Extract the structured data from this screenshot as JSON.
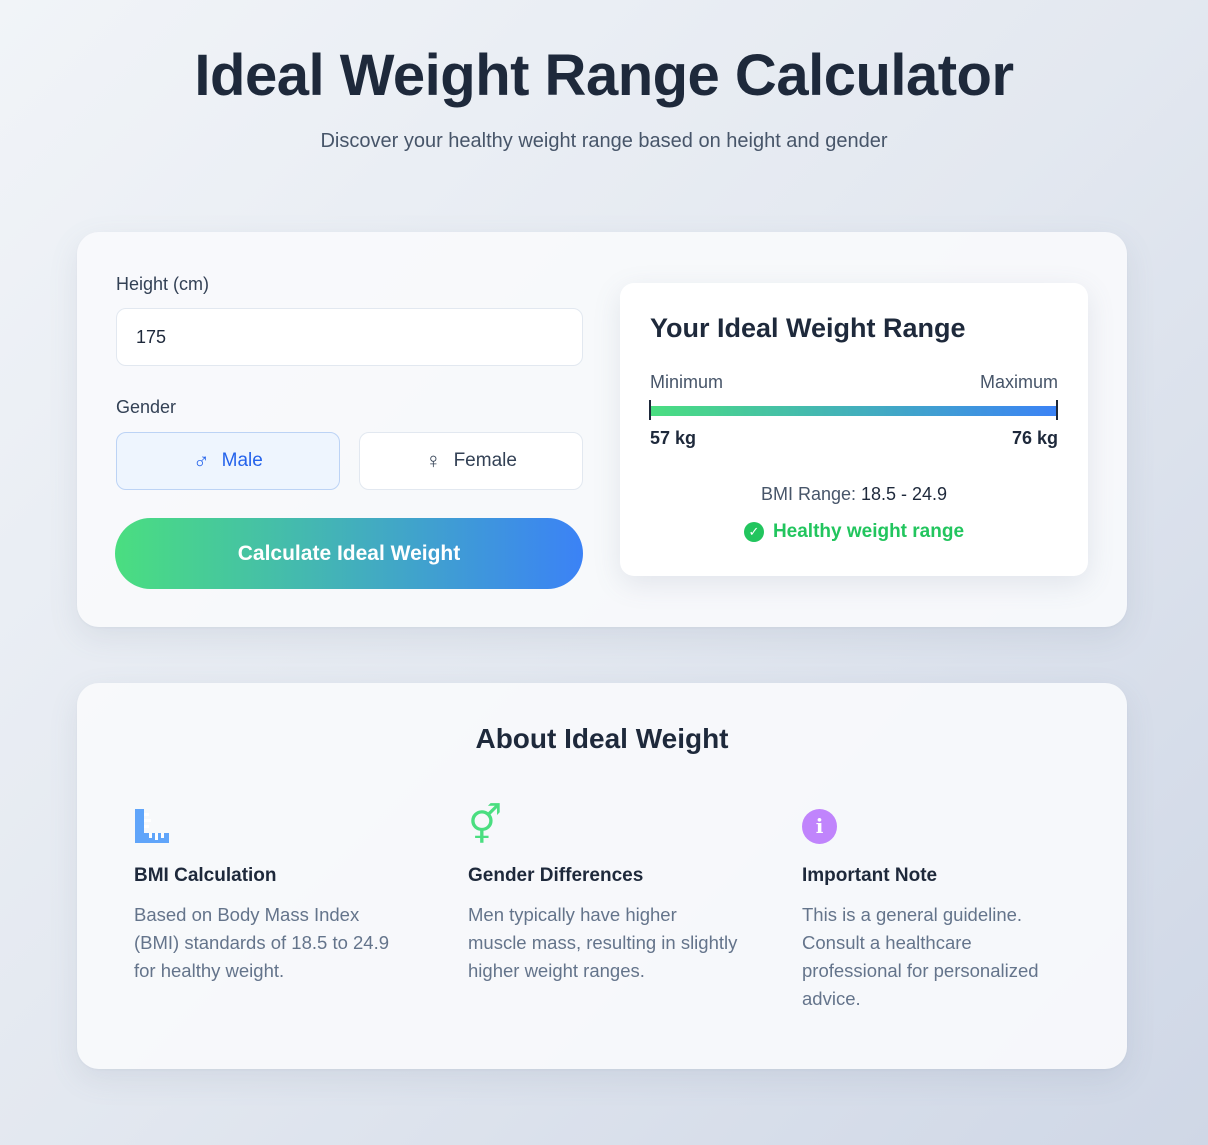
{
  "header": {
    "title": "Ideal Weight Range Calculator",
    "subtitle": "Discover your healthy weight range based on height and gender"
  },
  "form": {
    "height_label": "Height (cm)",
    "height_value": "175",
    "gender_label": "Gender",
    "male_label": "Male",
    "female_label": "Female",
    "selected_gender": "Male",
    "calculate_label": "Calculate Ideal Weight"
  },
  "result": {
    "title": "Your Ideal Weight Range",
    "min_label": "Minimum",
    "max_label": "Maximum",
    "min_value": "57 kg",
    "max_value": "76 kg",
    "bmi_label": "BMI Range:",
    "bmi_value": "18.5 - 24.9",
    "status": "Healthy weight range"
  },
  "about": {
    "title": "About Ideal Weight",
    "items": [
      {
        "icon": "ruler-icon",
        "title": "BMI Calculation",
        "text": "Based on Body Mass Index (BMI) standards of 18.5 to 24.9 for healthy weight."
      },
      {
        "icon": "gender-symbols-icon",
        "title": "Gender Differences",
        "text": "Men typically have higher muscle mass, resulting in slightly higher weight ranges."
      },
      {
        "icon": "info-icon",
        "title": "Important Note",
        "text": "This is a general guideline. Consult a healthcare professional for personalized advice."
      }
    ]
  },
  "colors": {
    "accent_green": "#4ade80",
    "accent_blue": "#3b82f6",
    "status_green": "#22c55e",
    "info_purple": "#c084fc",
    "ruler_blue": "#60a5fa"
  }
}
